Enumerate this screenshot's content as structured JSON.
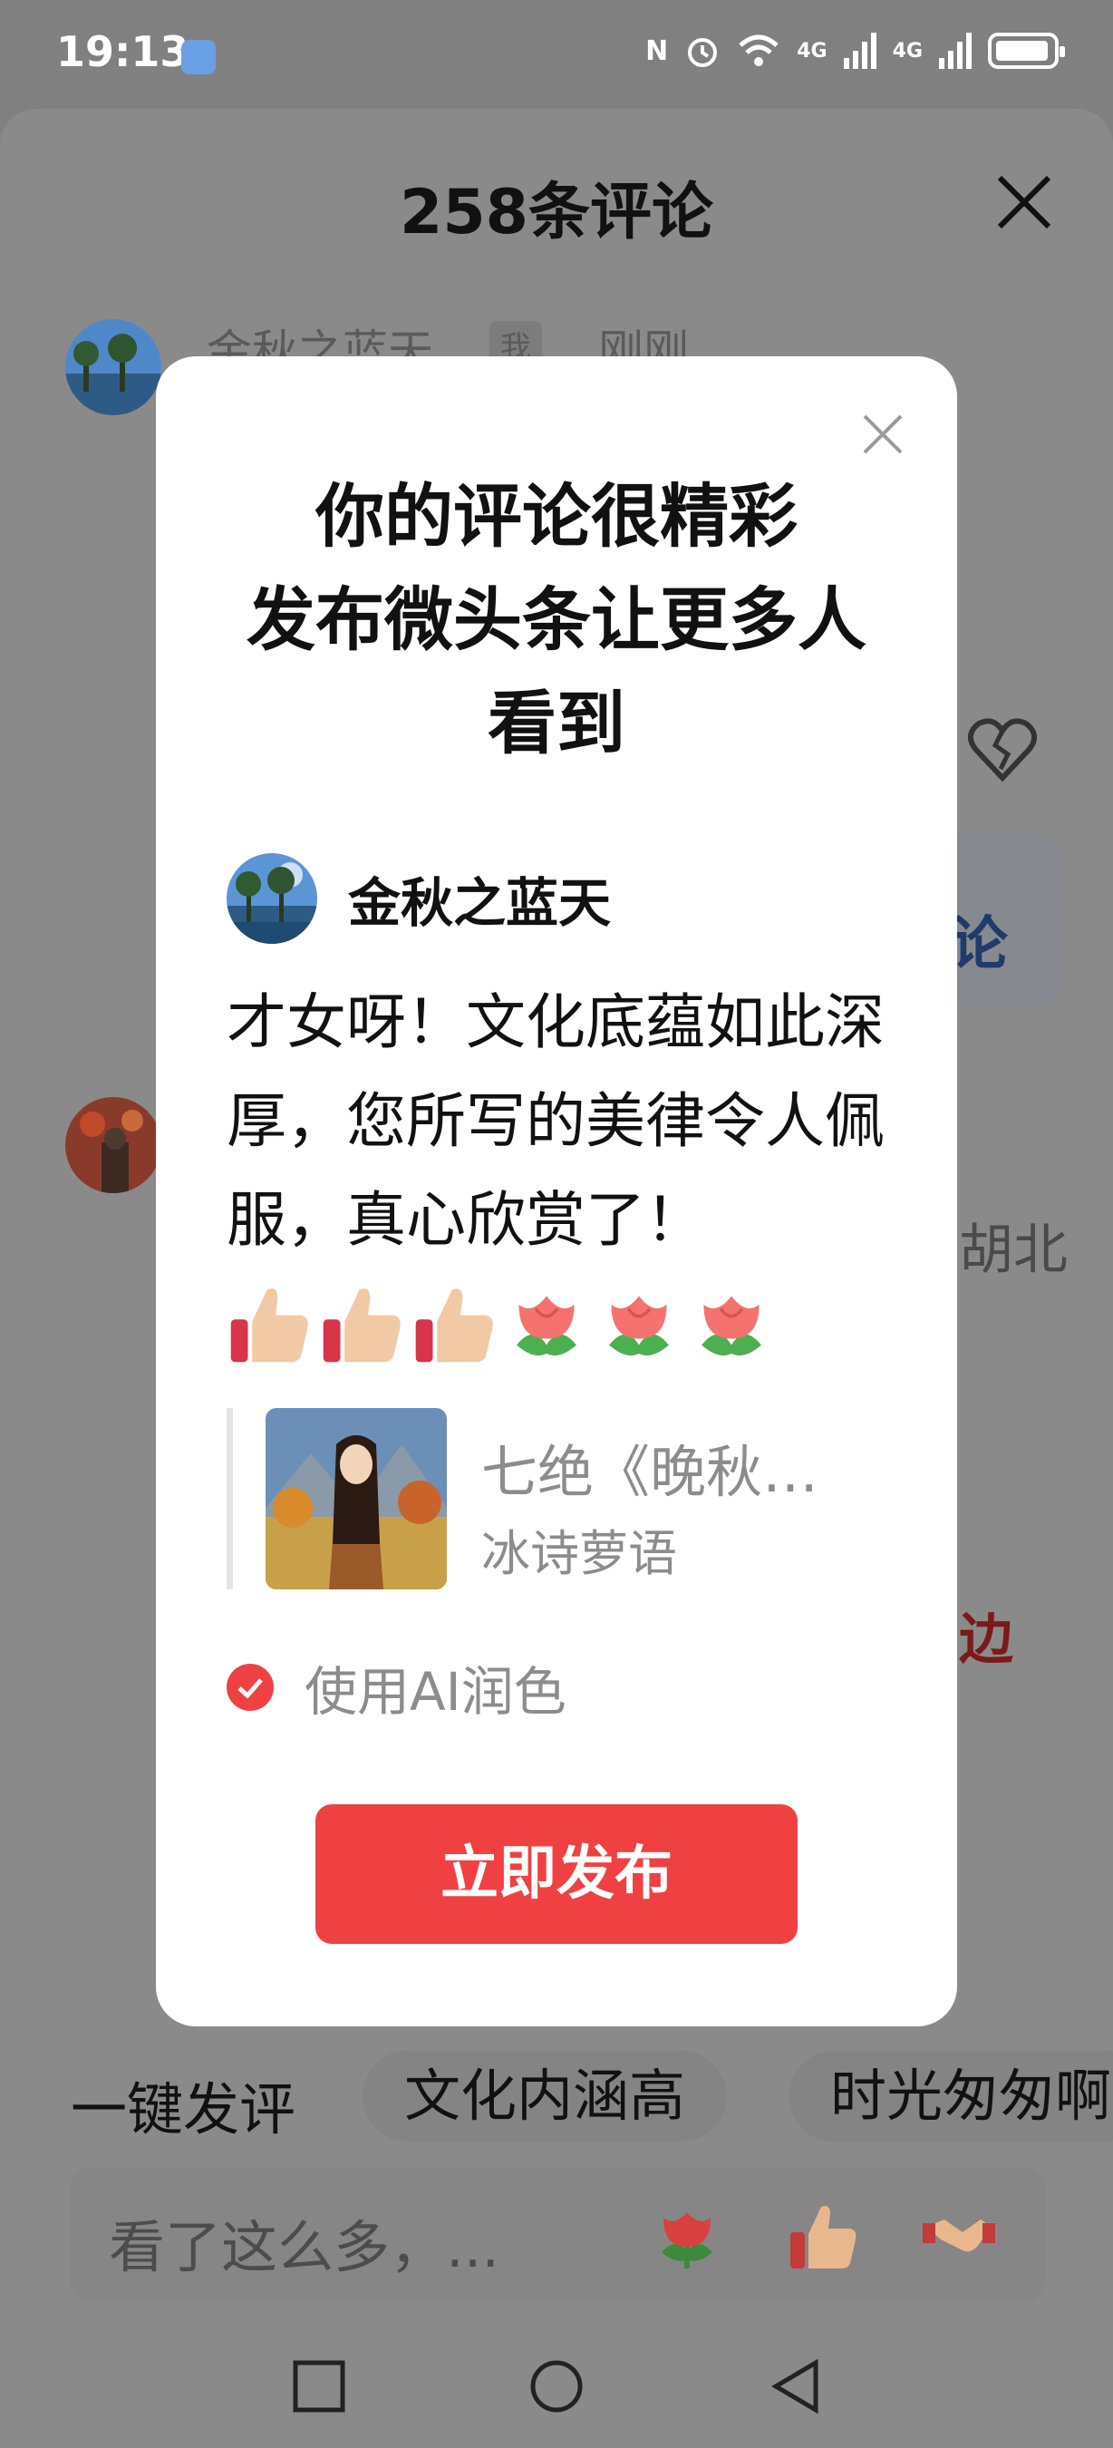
{
  "status_bar": {
    "time": "19:13",
    "nfc": "N",
    "network_1": "4G",
    "network_2": "4G",
    "battery_level": 0.95,
    "icons": [
      "app-icon",
      "nfc-icon",
      "alarm-icon",
      "wifi-icon",
      "signal-icon",
      "battery-icon"
    ]
  },
  "sheet": {
    "title": "258条评论",
    "close_icon": "close-icon",
    "bg_comment_1": {
      "name": "金秋之蓝天",
      "tag": "我",
      "time": "刚刚"
    },
    "bg_peek_right_1": "论",
    "bg_peek_right_2": "胡北",
    "bg_peek_right_3": "边",
    "dislike_icon": "broken-heart-icon"
  },
  "modal": {
    "close_icon": "close-icon",
    "title": "你的评论很精彩\n发布微头条让更多人\n看到",
    "author": "金秋之蓝天",
    "comment": "才女呀！文化底蕴如此深厚，您所写的美律令人佩服，真心欣赏了！",
    "emojis": [
      "thumbs-up-icon",
      "thumbs-up-icon",
      "thumbs-up-icon",
      "rose-icon",
      "rose-icon",
      "rose-icon"
    ],
    "quote": {
      "title": "七绝《晚秋…",
      "author": "冰诗萝语"
    },
    "ai_option": {
      "label": "使用AI润色",
      "checked": true
    },
    "publish_button": "立即发布"
  },
  "quick_reply": {
    "label": "一键发评",
    "chips": [
      "文化内涵高",
      "时光匆匆啊"
    ]
  },
  "input": {
    "placeholder": "看了这么多，...",
    "emojis": [
      "rose-icon",
      "thumbs-up-icon",
      "handshake-icon"
    ]
  },
  "nav": [
    "recents-icon",
    "home-icon",
    "back-icon"
  ],
  "colors": {
    "accent": "#f04142",
    "overlay": "#808080"
  }
}
